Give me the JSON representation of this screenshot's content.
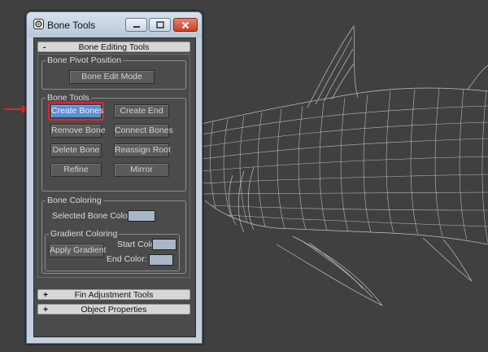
{
  "window": {
    "title": "Bone Tools",
    "minimize_icon": "minimize-icon",
    "maximize_icon": "maximize-icon",
    "close_icon": "close-icon"
  },
  "rollouts": {
    "bone_editing": {
      "expand_sign": "-",
      "title": "Bone Editing Tools",
      "pivot_group": {
        "label": "Bone Pivot Position",
        "edit_mode_button": "Bone Edit Mode"
      },
      "bone_tools_group": {
        "label": "Bone Tools",
        "buttons": {
          "create_bones": "Create Bones",
          "create_end": "Create End",
          "remove_bone": "Remove Bone",
          "connect_bones": "Connect Bones",
          "delete_bone": "Delete Bone",
          "reassign_root": "Reassign Root",
          "refine": "Refine",
          "mirror": "Mirror"
        }
      },
      "coloring_group": {
        "label": "Bone Coloring",
        "selected_color_label": "Selected Bone Color:",
        "gradient_group": {
          "label": "Gradient Coloring",
          "apply_button": "Apply Gradient",
          "start_color_label": "Start Color:",
          "end_color_label": "End Color:"
        }
      }
    },
    "fin_adjustment": {
      "expand_sign": "+",
      "title": "Fin Adjustment Tools"
    },
    "object_properties": {
      "expand_sign": "+",
      "title": "Object Properties"
    }
  },
  "colors": {
    "selected_bone_color": "#a9b6c8",
    "start_color": "#a9b6c8",
    "end_color": "#a9b6c8",
    "active_button": "#5d8ed0",
    "highlight": "#e42424",
    "viewport_bg": "#404040",
    "wireframe": "#d8d8d8"
  },
  "viewport": {
    "content": "shark-wireframe-model"
  }
}
